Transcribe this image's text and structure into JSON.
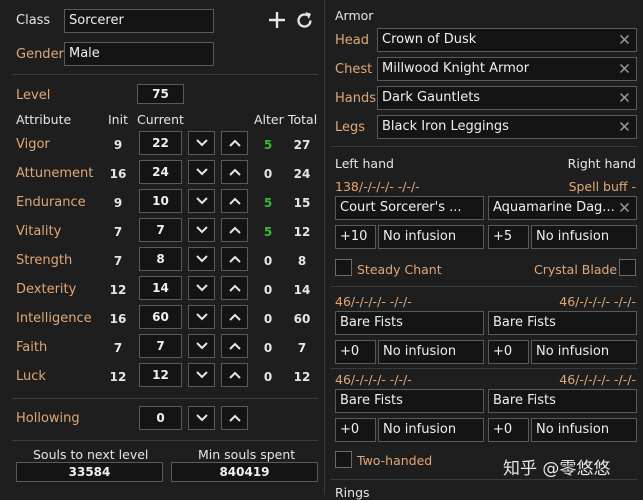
{
  "left": {
    "class_label": "Class",
    "class_value": "Sorcerer",
    "gender_label": "Gender",
    "gender_value": "Male",
    "level_label": "Level",
    "level_value": "75",
    "headers": {
      "attribute": "Attribute",
      "init": "Init",
      "current": "Current",
      "alter": "Alter",
      "total": "Total"
    },
    "attributes": [
      {
        "name": "Vigor",
        "init": "9",
        "current": "22",
        "alter": "5",
        "total": "27",
        "alter_green": true
      },
      {
        "name": "Attunement",
        "init": "16",
        "current": "24",
        "alter": "0",
        "total": "24",
        "alter_green": false
      },
      {
        "name": "Endurance",
        "init": "9",
        "current": "10",
        "alter": "5",
        "total": "15",
        "alter_green": true
      },
      {
        "name": "Vitality",
        "init": "7",
        "current": "7",
        "alter": "5",
        "total": "12",
        "alter_green": true
      },
      {
        "name": "Strength",
        "init": "7",
        "current": "8",
        "alter": "0",
        "total": "8",
        "alter_green": false
      },
      {
        "name": "Dexterity",
        "init": "12",
        "current": "14",
        "alter": "0",
        "total": "14",
        "alter_green": false
      },
      {
        "name": "Intelligence",
        "init": "16",
        "current": "60",
        "alter": "0",
        "total": "60",
        "alter_green": false
      },
      {
        "name": "Faith",
        "init": "7",
        "current": "7",
        "alter": "0",
        "total": "7",
        "alter_green": false
      },
      {
        "name": "Luck",
        "init": "12",
        "current": "12",
        "alter": "0",
        "total": "12",
        "alter_green": false
      }
    ],
    "hollowing_label": "Hollowing",
    "hollowing_value": "0",
    "souls_next_label": "Souls to next level",
    "souls_next_value": "33584",
    "min_souls_label": "Min souls spent",
    "min_souls_value": "840419"
  },
  "right": {
    "armor_label": "Armor",
    "armor": [
      {
        "slot": "Head",
        "item": "Crown of Dusk"
      },
      {
        "slot": "Chest",
        "item": "Millwood Knight Armor"
      },
      {
        "slot": "Hands",
        "item": "Dark Gauntlets"
      },
      {
        "slot": "Legs",
        "item": "Black Iron Leggings"
      }
    ],
    "left_hand_label": "Left hand",
    "right_hand_label": "Right hand",
    "block1": {
      "left_stats": "138/-/-/-/-  -/-/-",
      "right_stats": "Spell buff -",
      "left_weapon": "Court Sorcerer's ...",
      "right_weapon": "Aquamarine Dag...",
      "left_plus": "+10",
      "left_infusion": "No infusion",
      "right_plus": "+5",
      "right_infusion": "No infusion",
      "left_check": "Steady Chant",
      "right_check": "Crystal Blade"
    },
    "block2": {
      "left_stats": "46/-/-/-/-  -/-/-",
      "right_stats": "46/-/-/-/-  -/-/-",
      "left_weapon": "Bare Fists",
      "right_weapon": "Bare Fists",
      "left_plus": "+0",
      "left_infusion": "No infusion",
      "right_plus": "+0",
      "right_infusion": "No infusion"
    },
    "block3": {
      "left_stats": "46/-/-/-/-  -/-/-",
      "right_stats": "46/-/-/-/-  -/-/-",
      "left_weapon": "Bare Fists",
      "right_weapon": "Bare Fists",
      "left_plus": "+0",
      "left_infusion": "No infusion",
      "right_plus": "+0",
      "right_infusion": "No infusion"
    },
    "two_handed_label": "Two-handed",
    "rings_label": "Rings",
    "watermark": "知乎 @零悠悠"
  }
}
